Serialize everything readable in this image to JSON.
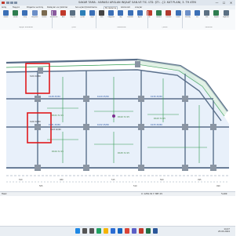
{
  "app": {
    "title": "SAKAR TAMA - KARASU ARSLAN İNŞAAT SAN.VE TİC. LTD. ŞTİ. - [2. KAT PLANI, 3. TH ATİN]",
    "window_buttons": [
      "—",
      "☐",
      "✕"
    ]
  },
  "tabs": [
    {
      "label": "Giriş"
    },
    {
      "label": "Taşıyıcı"
    },
    {
      "label": "Döşeme ve Kiriş"
    },
    {
      "label": "Detaylar ve Çizimler"
    },
    {
      "label": "Sonuçlar/Çözümleme"
    },
    {
      "label": "Modelleme"
    },
    {
      "label": "Görünüm"
    },
    {
      "label": "Araçlar"
    }
  ],
  "ribbon": {
    "buttons": [
      {
        "label": "Kolon",
        "icon": "column-icon",
        "color": "#3b6fb6"
      },
      {
        "label": "Perde",
        "icon": "wall-icon",
        "color": "#2e7d4f"
      },
      {
        "label": "Kiriş",
        "icon": "beam-icon",
        "color": "#3b6fb6"
      },
      {
        "label": "Döşeme",
        "icon": "slab-icon",
        "color": "#6c8fc7"
      },
      {
        "label": "Temel",
        "icon": "foundation-icon",
        "color": "#7a6a4f"
      },
      {
        "label": "Merdiven",
        "icon": "stairs-icon",
        "color": "#8a5a9e"
      },
      {
        "label": "Aks",
        "icon": "axis-icon",
        "color": "#c0392b"
      },
      {
        "label": "Boşluk",
        "icon": "opening-icon",
        "color": "#5b7083"
      },
      {
        "label": "Çizim",
        "icon": "draw-icon",
        "color": "#2c7fb8"
      },
      {
        "label": "Ölçü",
        "icon": "dimension-icon",
        "color": "#3b6fb6"
      },
      {
        "label": "Yazı",
        "icon": "text-icon",
        "color": "#444444"
      },
      {
        "label": "Kopyala",
        "icon": "copy-icon",
        "color": "#3b6fb6"
      },
      {
        "label": "Taşı",
        "icon": "move-icon",
        "color": "#3b6fb6"
      },
      {
        "label": "Döndür",
        "icon": "rotate-icon",
        "color": "#3b6fb6"
      },
      {
        "label": "Ayna",
        "icon": "mirror-icon",
        "color": "#3b6fb6"
      },
      {
        "label": "Sil",
        "icon": "delete-icon",
        "color": "#c0392b"
      },
      {
        "label": "Analiz",
        "icon": "analysis-icon",
        "color": "#2e7d4f"
      },
      {
        "label": "Donatı",
        "icon": "rebar-icon",
        "color": "#b03a2e"
      },
      {
        "label": "Pafta",
        "icon": "sheet-icon",
        "color": "#3b6fb6"
      },
      {
        "label": "Metraj",
        "icon": "quantity-icon",
        "color": "#6c8fc7"
      },
      {
        "label": "3D",
        "icon": "3d-view-icon",
        "color": "#3b6fb6"
      },
      {
        "label": "Kat",
        "icon": "floor-icon",
        "color": "#5b7083"
      },
      {
        "label": "Rapor",
        "icon": "report-icon",
        "color": "#2e7d4f"
      },
      {
        "label": "Ayarlar",
        "icon": "settings-icon",
        "color": "#5b7083"
      }
    ],
    "groups": [
      "Taşıyıcı Elemanlar",
      "Çizim",
      "Düzenleme",
      "Çözüm",
      "Görünüm"
    ]
  },
  "plan": {
    "beam_labels": [
      "K128 25/50",
      "K129 25/50",
      "K130 25/50",
      "K131 25/50",
      "K132 25/50",
      "K133 25/50"
    ],
    "slab_labels": [
      "D101 h=15",
      "D102 h=15",
      "D103 h=15",
      "D104 h=15",
      "D105 h=15"
    ],
    "column_labels": [
      "S101 40/60",
      "S102 40/60",
      "S103 40/60"
    ],
    "dimension_labels": [
      "520",
      "480",
      "515",
      "500",
      "495",
      "505",
      "510",
      "490"
    ]
  },
  "statusbar": {
    "text": "Hazır",
    "coords": "X: 1254.32  Y: 887.15",
    "zoom": "%100"
  },
  "taskbar": {
    "icons": [
      {
        "name": "windows-start-icon",
        "color": "#1e88e5"
      },
      {
        "name": "search-icon",
        "color": "#555555"
      },
      {
        "name": "task-view-icon",
        "color": "#555555"
      },
      {
        "name": "edge-icon",
        "color": "#1fa463"
      },
      {
        "name": "file-explorer-icon",
        "color": "#f5b400"
      },
      {
        "name": "store-icon",
        "color": "#2b6cd3"
      },
      {
        "name": "mail-icon",
        "color": "#1565c0"
      },
      {
        "name": "chrome-icon",
        "color": "#db4437"
      },
      {
        "name": "teams-icon",
        "color": "#5b5fc7"
      },
      {
        "name": "sakar-app-icon",
        "color": "#c0392b"
      },
      {
        "name": "excel-icon",
        "color": "#1e7145"
      },
      {
        "name": "word-icon",
        "color": "#2b579a"
      }
    ],
    "time": "14:27",
    "date": "25.03.2024"
  }
}
